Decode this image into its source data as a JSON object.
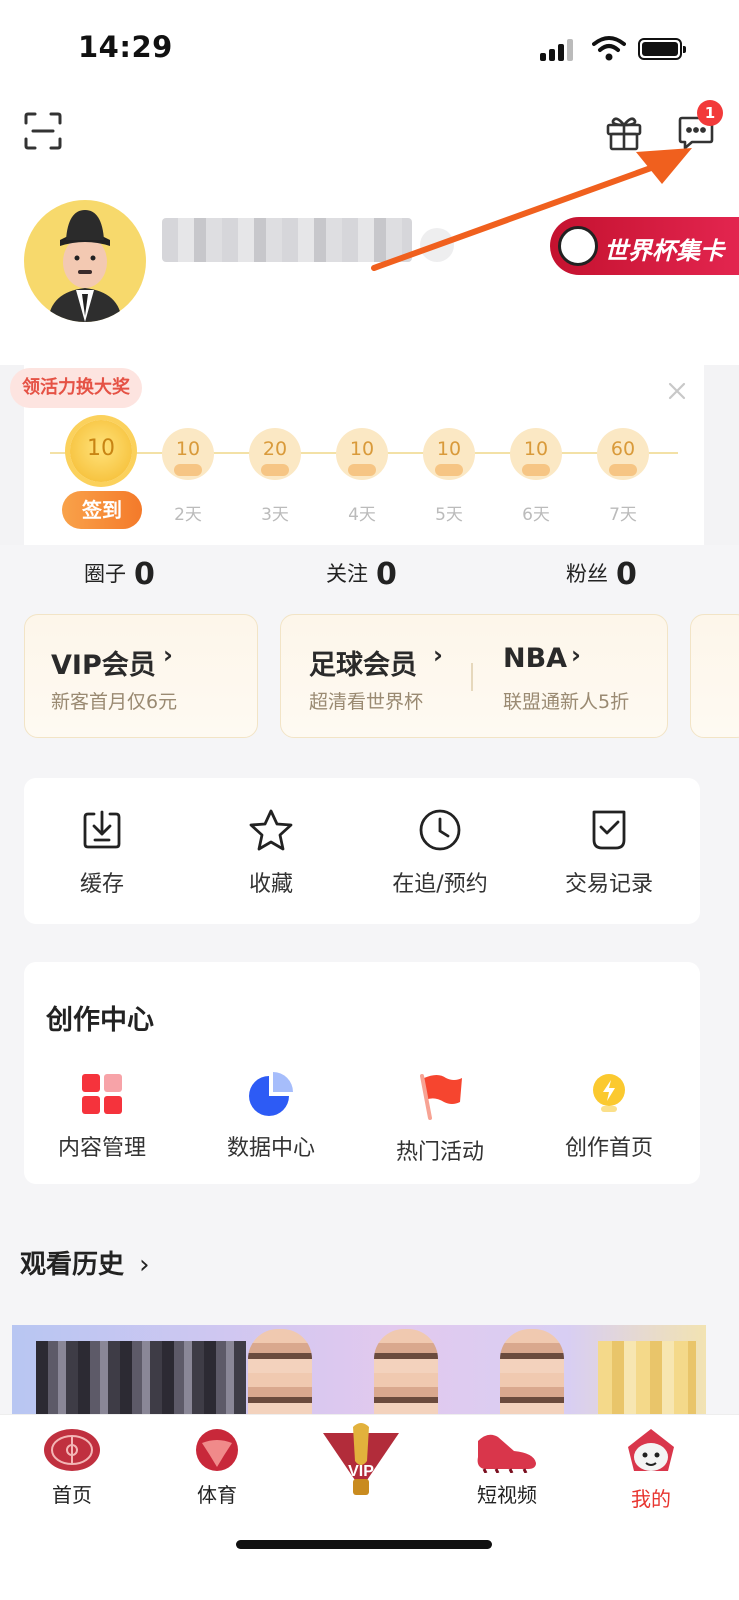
{
  "status_bar": {
    "time": "14:29"
  },
  "header": {
    "message_badge": "1"
  },
  "profile": {
    "world_cup_card": "世界杯集卡"
  },
  "checkin": {
    "tag": "领活力换大奖",
    "button": "签到",
    "days": [
      {
        "value": "10",
        "label": ""
      },
      {
        "value": "10",
        "label": "2天"
      },
      {
        "value": "20",
        "label": "3天"
      },
      {
        "value": "10",
        "label": "4天"
      },
      {
        "value": "10",
        "label": "5天"
      },
      {
        "value": "10",
        "label": "6天"
      },
      {
        "value": "60",
        "label": "7天"
      }
    ]
  },
  "stats": [
    {
      "label": "圈子",
      "value": "0"
    },
    {
      "label": "关注",
      "value": "0"
    },
    {
      "label": "粉丝",
      "value": "0"
    }
  ],
  "memberships": {
    "vip": {
      "title": "VIP会员",
      "sub": "新客首月仅6元"
    },
    "football": {
      "title": "足球会员",
      "sub": "超清看世界杯"
    },
    "nba": {
      "title": "NBA",
      "sub": "联盟通新人5折"
    }
  },
  "tools": [
    {
      "label": "缓存"
    },
    {
      "label": "收藏"
    },
    {
      "label": "在追/预约"
    },
    {
      "label": "交易记录"
    }
  ],
  "creator": {
    "title": "创作中心",
    "items": [
      {
        "label": "内容管理"
      },
      {
        "label": "数据中心"
      },
      {
        "label": "热门活动"
      },
      {
        "label": "创作首页"
      }
    ]
  },
  "history": {
    "title": "观看历史"
  },
  "tabbar": [
    {
      "label": "首页"
    },
    {
      "label": "体育"
    },
    {
      "label": "VIP"
    },
    {
      "label": "短视频"
    },
    {
      "label": "我的"
    }
  ],
  "colors": {
    "accent_red": "#f23a3a",
    "arrow": "#f0601e",
    "active_tab": "#e8352f"
  }
}
